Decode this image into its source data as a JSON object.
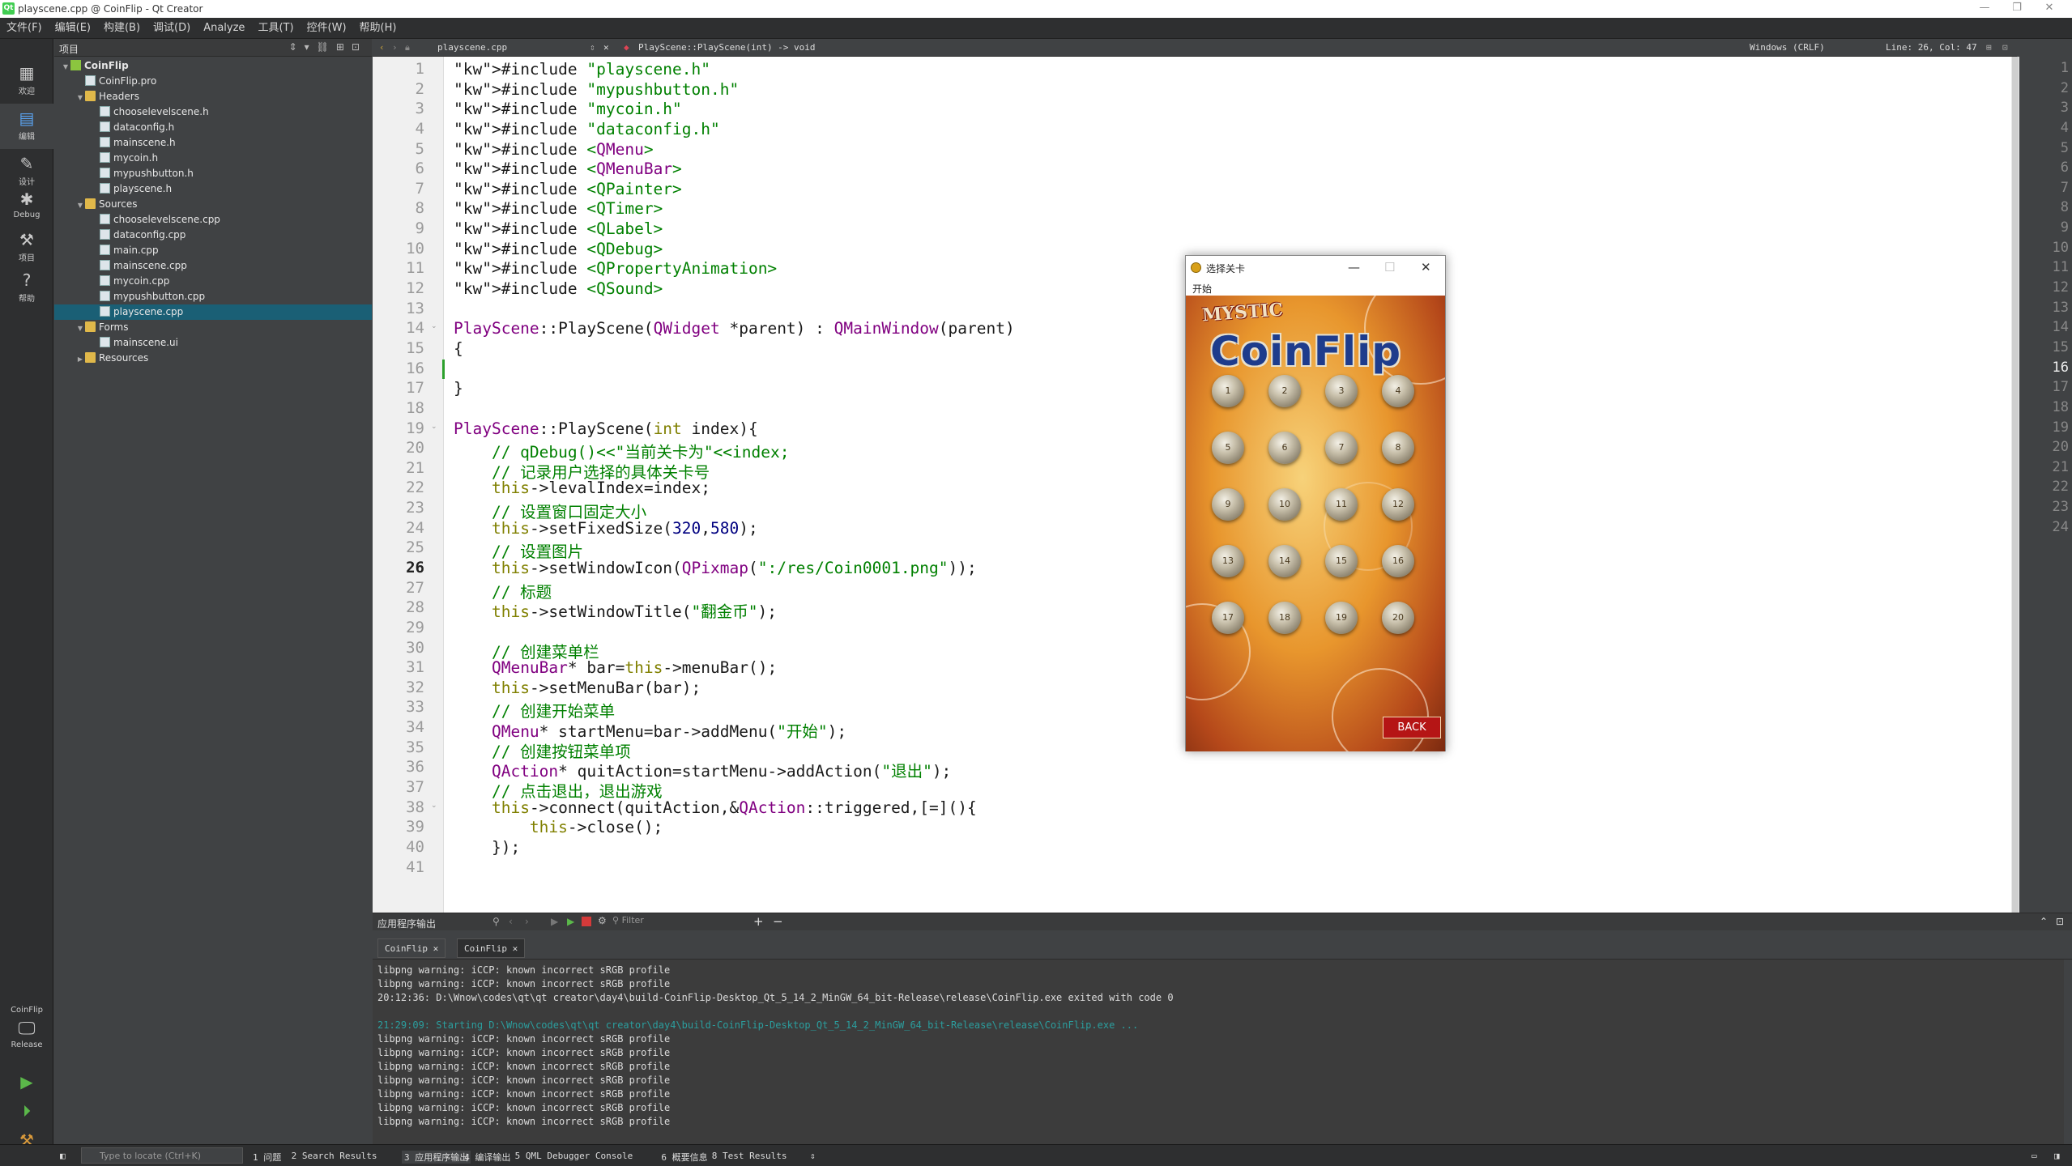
{
  "window": {
    "title": "playscene.cpp @ CoinFlip - Qt Creator"
  },
  "menu": [
    "文件(F)",
    "编辑(E)",
    "构建(B)",
    "调试(D)",
    "Analyze",
    "工具(T)",
    "控件(W)",
    "帮助(H)"
  ],
  "modes": [
    "欢迎",
    "编辑",
    "设计",
    "Debug",
    "项目",
    "帮助"
  ],
  "kit": {
    "project": "CoinFlip",
    "build": "Release"
  },
  "sidebar": {
    "title": "项目",
    "tree": [
      {
        "label": "CoinFlip",
        "type": "proj",
        "level": 0,
        "arrow": "▼"
      },
      {
        "label": "CoinFlip.pro",
        "type": "file",
        "level": 1
      },
      {
        "label": "Headers",
        "type": "folder",
        "level": 1,
        "arrow": "▼"
      },
      {
        "label": "chooselevelscene.h",
        "type": "file",
        "level": 2
      },
      {
        "label": "dataconfig.h",
        "type": "file",
        "level": 2
      },
      {
        "label": "mainscene.h",
        "type": "file",
        "level": 2
      },
      {
        "label": "mycoin.h",
        "type": "file",
        "level": 2
      },
      {
        "label": "mypushbutton.h",
        "type": "file",
        "level": 2
      },
      {
        "label": "playscene.h",
        "type": "file",
        "level": 2
      },
      {
        "label": "Sources",
        "type": "folder",
        "level": 1,
        "arrow": "▼"
      },
      {
        "label": "chooselevelscene.cpp",
        "type": "cpp",
        "level": 2
      },
      {
        "label": "dataconfig.cpp",
        "type": "cpp",
        "level": 2
      },
      {
        "label": "main.cpp",
        "type": "cpp",
        "level": 2
      },
      {
        "label": "mainscene.cpp",
        "type": "cpp",
        "level": 2
      },
      {
        "label": "mycoin.cpp",
        "type": "cpp",
        "level": 2
      },
      {
        "label": "mypushbutton.cpp",
        "type": "cpp",
        "level": 2
      },
      {
        "label": "playscene.cpp",
        "type": "cpp",
        "level": 2,
        "selected": true
      },
      {
        "label": "Forms",
        "type": "folder",
        "level": 1,
        "arrow": "▼"
      },
      {
        "label": "mainscene.ui",
        "type": "file",
        "level": 2
      },
      {
        "label": "Resources",
        "type": "folder",
        "level": 1,
        "arrow": "▶"
      }
    ]
  },
  "editor": {
    "file_tab": "playscene.cpp",
    "symbol": "PlayScene::PlayScene(int) -> void",
    "encoding": "Windows (CRLF)",
    "position": "Line: 26, Col: 47",
    "current_line": 26,
    "lines": [
      "#include \"playscene.h\"",
      "#include \"mypushbutton.h\"",
      "#include \"mycoin.h\"",
      "#include \"dataconfig.h\"",
      "#include <QMenu>",
      "#include <QMenuBar>",
      "#include <QPainter>",
      "#include <QTimer>",
      "#include <QLabel>",
      "#include <QDebug>",
      "#include <QPropertyAnimation>",
      "#include <QSound>",
      "",
      "PlayScene::PlayScene(QWidget *parent) : QMainWindow(parent)",
      "{",
      "",
      "}",
      "",
      "PlayScene::PlayScene(int index){",
      "    // qDebug()<<\"当前关卡为\"<<index;",
      "    // 记录用户选择的具体关卡号",
      "    this->levalIndex=index;",
      "    // 设置窗口固定大小",
      "    this->setFixedSize(320,580);",
      "    // 设置图片",
      "    this->setWindowIcon(QPixmap(\":/res/Coin0001.png\"));",
      "    // 标题",
      "    this->setWindowTitle(\"翻金币\");",
      "",
      "    // 创建菜单栏",
      "    QMenuBar* bar=this->menuBar();",
      "    this->setMenuBar(bar);",
      "    // 创建开始菜单",
      "    QMenu* startMenu=bar->addMenu(\"开始\");",
      "    // 创建按钮菜单项",
      "    QAction* quitAction=startMenu->addAction(\"退出\");",
      "    // 点击退出，退出游戏",
      "    this->connect(quitAction,&QAction::triggered,[=](){",
      "        this->close();",
      "    });",
      ""
    ]
  },
  "output": {
    "title": "应用程序输出",
    "filter_placeholder": "Filter",
    "tabs": [
      "CoinFlip",
      "CoinFlip"
    ],
    "lines": [
      {
        "text": "libpng warning: iCCP: known incorrect sRGB profile",
        "style": "normal"
      },
      {
        "text": "libpng warning: iCCP: known incorrect sRGB profile",
        "style": "normal"
      },
      {
        "text": "20:12:36: D:\\Wnow\\codes\\qt\\qt creator\\day4\\build-CoinFlip-Desktop_Qt_5_14_2_MinGW_64_bit-Release\\release\\CoinFlip.exe exited with code 0",
        "style": "normal"
      },
      {
        "text": "",
        "style": "normal"
      },
      {
        "text": "21:29:09: Starting D:\\Wnow\\codes\\qt\\qt creator\\day4\\build-CoinFlip-Desktop_Qt_5_14_2_MinGW_64_bit-Release\\release\\CoinFlip.exe ...",
        "style": "teal"
      },
      {
        "text": "libpng warning: iCCP: known incorrect sRGB profile",
        "style": "normal"
      },
      {
        "text": "libpng warning: iCCP: known incorrect sRGB profile",
        "style": "normal"
      },
      {
        "text": "libpng warning: iCCP: known incorrect sRGB profile",
        "style": "normal"
      },
      {
        "text": "libpng warning: iCCP: known incorrect sRGB profile",
        "style": "normal"
      },
      {
        "text": "libpng warning: iCCP: known incorrect sRGB profile",
        "style": "normal"
      },
      {
        "text": "libpng warning: iCCP: known incorrect sRGB profile",
        "style": "normal"
      },
      {
        "text": "libpng warning: iCCP: known incorrect sRGB profile",
        "style": "normal"
      }
    ]
  },
  "statusbar": {
    "locate_placeholder": "Type to locate (Ctrl+K)",
    "panes": [
      "1 问题",
      "2 Search Results",
      "3 应用程序输出",
      "4 编译输出",
      "5 QML Debugger Console",
      "6 概要信息",
      "8 Test Results"
    ]
  },
  "game": {
    "title": "选择关卡",
    "menu": "开始",
    "logo_top": "MYSTIC",
    "logo_main": "CoinFlip",
    "levels": [
      "1",
      "2",
      "3",
      "4",
      "5",
      "6",
      "7",
      "8",
      "9",
      "10",
      "11",
      "12",
      "13",
      "14",
      "15",
      "16",
      "17",
      "18",
      "19",
      "20"
    ],
    "back": "BACK"
  }
}
